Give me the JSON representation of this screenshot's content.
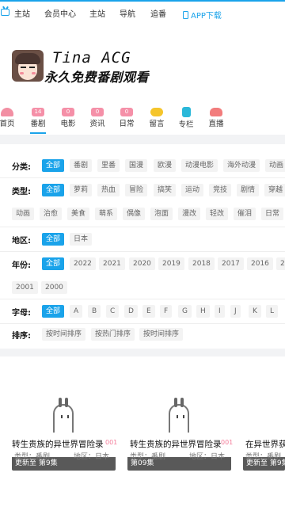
{
  "topbar": {
    "items": [
      "主站",
      "会员中心",
      "主站",
      "导航",
      "追番"
    ],
    "app_download": "APP下载"
  },
  "brand": {
    "title": "Tina ACG",
    "subtitle": "永久免费番剧观看"
  },
  "categories": [
    {
      "label": "首页",
      "icon": "home-icon",
      "color": "#f28fa3",
      "badge": ""
    },
    {
      "label": "番剧",
      "icon": "tv-icon",
      "color": "#f590a8",
      "badge": "14"
    },
    {
      "label": "电影",
      "icon": "film-icon",
      "color": "#f590a8",
      "badge": "0"
    },
    {
      "label": "资讯",
      "icon": "news-icon",
      "color": "#f590a8",
      "badge": "0"
    },
    {
      "label": "日常",
      "icon": "daily-icon",
      "color": "#f590a8",
      "badge": "0"
    },
    {
      "label": "留言",
      "icon": "chat-icon",
      "color": "#f5c52b",
      "badge": ""
    },
    {
      "label": "专栏",
      "icon": "column-icon",
      "color": "#2bb8d9",
      "badge": ""
    },
    {
      "label": "直播",
      "icon": "live-icon",
      "color": "#f27c7c",
      "badge": ""
    }
  ],
  "filters": {
    "category": {
      "label": "分类:",
      "options": [
        "全部",
        "番剧",
        "里番",
        "国漫",
        "欧漫",
        "动漫电影",
        "海外动漫",
        "动画"
      ]
    },
    "type": {
      "label": "类型:",
      "options": [
        "全部",
        "萝莉",
        "热血",
        "冒险",
        "搞笑",
        "运动",
        "竞技",
        "剧情",
        "穿越"
      ],
      "options2": [
        "动画",
        "治愈",
        "美食",
        "萌系",
        "偶像",
        "泡面",
        "漫改",
        "轻改",
        "催泪",
        "日常"
      ]
    },
    "region": {
      "label": "地区:",
      "options": [
        "全部",
        "日本"
      ]
    },
    "year": {
      "label": "年份:",
      "options": [
        "全部",
        "2022",
        "2021",
        "2020",
        "2019",
        "2018",
        "2017",
        "2016",
        "2"
      ],
      "options2": [
        "2001",
        "2000"
      ]
    },
    "letter": {
      "label": "字母:",
      "options": [
        "全部",
        "A",
        "B",
        "C",
        "D",
        "E",
        "F",
        "G",
        "H",
        "I",
        "J",
        "K",
        "L"
      ]
    },
    "sort": {
      "label": "排序:",
      "options": [
        "按时间排序",
        "按热门排序",
        "按时间排序"
      ]
    }
  },
  "cards": [
    {
      "status": "更新至 第9集",
      "title": "转生贵族的异世界冒险录",
      "type": "类型：番剧",
      "region": "地区：日本",
      "pink": "001"
    },
    {
      "status": "第09集",
      "title": "转生贵族的异世界冒险录",
      "type": "类型：番剧",
      "region": "地区：日本",
      "pink": "001"
    },
    {
      "status": "更新至 第9集",
      "title": "在异世界获",
      "type": "类型：番剧",
      "region": "",
      "pink": ""
    }
  ]
}
